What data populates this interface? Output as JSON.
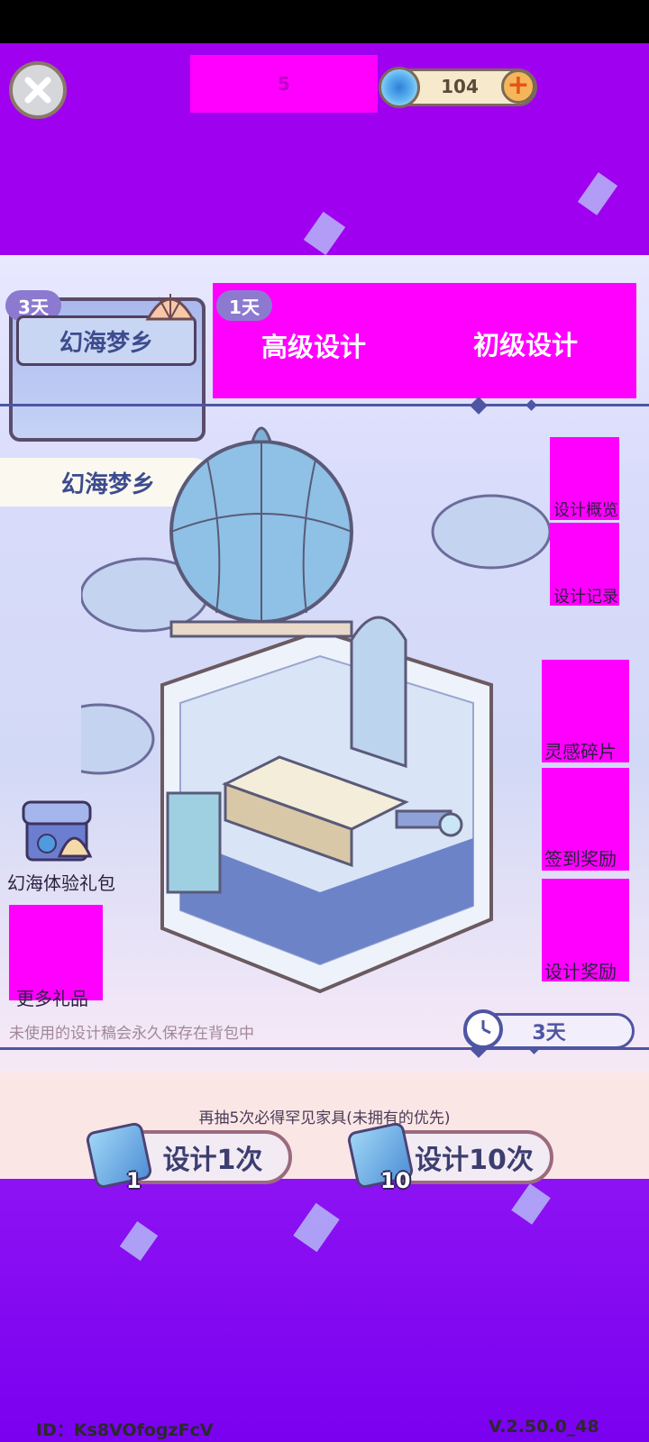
{
  "header": {
    "close_icon": "close-x-icon",
    "masked_label": "5",
    "currency": {
      "icon": "swirl-gem-icon",
      "value": "104",
      "plus_icon": "plus-icon"
    }
  },
  "banner": {
    "days_badge": "3天",
    "title": "幻海梦乡"
  },
  "tabs": {
    "days_badge": "1天",
    "items": [
      {
        "label": "高级设计"
      },
      {
        "label": "初级设计"
      }
    ]
  },
  "theme_label": "幻海梦乡",
  "side_buttons": [
    {
      "label": "设计概览"
    },
    {
      "label": "设计记录"
    },
    {
      "label": "灵感碎片"
    },
    {
      "label": "签到奖励"
    },
    {
      "label": "设计奖励"
    }
  ],
  "left_buttons": {
    "gift_pack": "幻海体验礼包",
    "more_gifts": "更多礼品"
  },
  "timer": {
    "icon": "clock-icon",
    "value": "3天"
  },
  "hint": "未使用的设计稿会永久保存在背包中",
  "pity_text": "再抽5次必得罕见家具(未拥有的优先)",
  "draw_buttons": [
    {
      "label": "设计1次",
      "ticket_count": "1"
    },
    {
      "label": "设计10次",
      "ticket_count": "10"
    }
  ],
  "footer": {
    "id": "ID：Ks8VOfogzFcV",
    "version": "V.2.50.0_48"
  },
  "colors": {
    "accent_purple": "#a000f0",
    "mask_magenta": "#ff00ff",
    "divider_blue": "#4e55a2"
  }
}
